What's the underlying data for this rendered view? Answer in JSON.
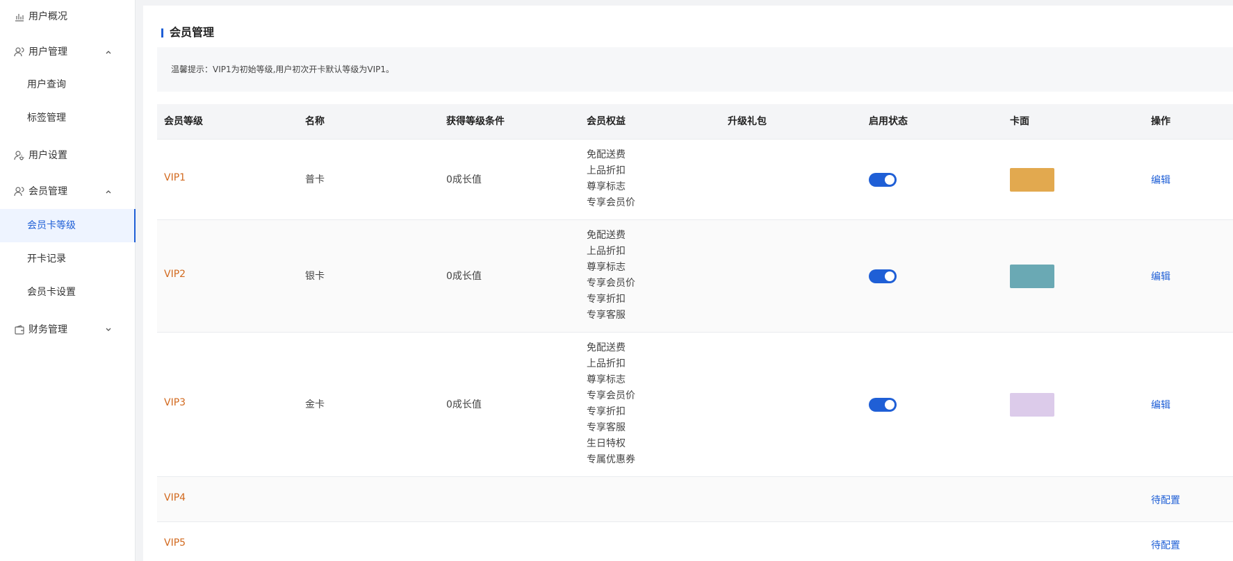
{
  "sidebar": {
    "items": [
      {
        "label": "用户概况",
        "icon": "bar-chart-icon"
      },
      {
        "label": "用户管理",
        "icon": "users-icon",
        "expanded": true,
        "children": [
          {
            "label": "用户查询"
          },
          {
            "label": "标签管理"
          }
        ]
      },
      {
        "label": "用户设置",
        "icon": "user-settings-icon"
      },
      {
        "label": "会员管理",
        "icon": "members-icon",
        "expanded": true,
        "children": [
          {
            "label": "会员卡等级",
            "active": true
          },
          {
            "label": "开卡记录"
          },
          {
            "label": "会员卡设置"
          }
        ]
      },
      {
        "label": "财务管理",
        "icon": "wallet-icon",
        "expanded": false
      }
    ]
  },
  "main": {
    "title": "会员管理",
    "tip": "温馨提示：VIP1为初始等级,用户初次开卡默认等级为VIP1。"
  },
  "table": {
    "columns": [
      "会员等级",
      "名称",
      "获得等级条件",
      "会员权益",
      "升级礼包",
      "启用状态",
      "卡面",
      "操作"
    ],
    "rows": [
      {
        "level": "VIP1",
        "name": "普卡",
        "condition": "0成长值",
        "perks": [
          "免配送费",
          "上品折扣",
          "尊享标志",
          "专享会员价"
        ],
        "enabled": true,
        "card_color": "#e2a94f",
        "action": "编辑"
      },
      {
        "level": "VIP2",
        "name": "银卡",
        "condition": "0成长值",
        "perks": [
          "免配送费",
          "上品折扣",
          "尊享标志",
          "专享会员价",
          "专享折扣",
          "专享客服"
        ],
        "enabled": true,
        "card_color": "#6aa9b4",
        "action": "编辑"
      },
      {
        "level": "VIP3",
        "name": "金卡",
        "condition": "0成长值",
        "perks": [
          "免配送费",
          "上品折扣",
          "尊享标志",
          "专享会员价",
          "专享折扣",
          "专享客服",
          "生日特权",
          "专属优惠券"
        ],
        "enabled": true,
        "card_color": "#dccbea",
        "action": "编辑"
      },
      {
        "level": "VIP4",
        "action": "待配置"
      },
      {
        "level": "VIP5",
        "action": "待配置"
      }
    ]
  },
  "colors": {
    "accent": "#1f5fd6",
    "level_text": "#d2691e"
  }
}
